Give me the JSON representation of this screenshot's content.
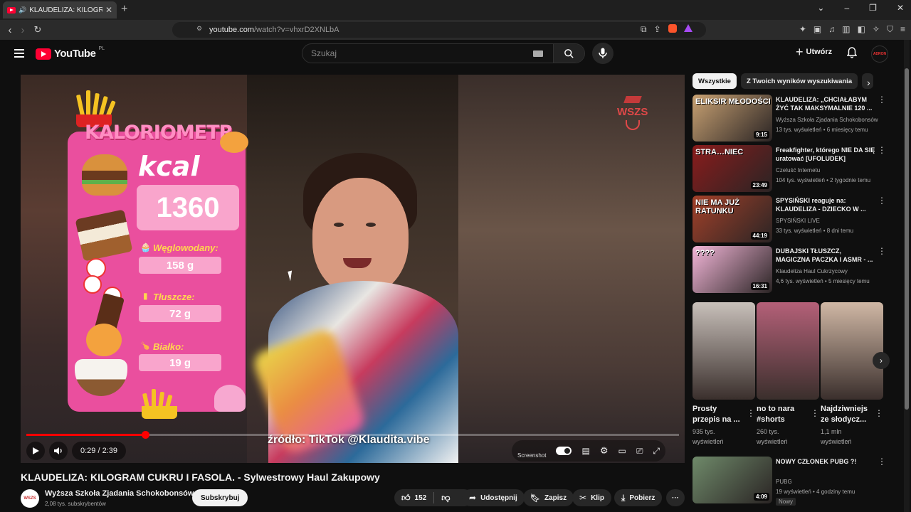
{
  "browser": {
    "tab_title": "KLAUDELIZA: KILOGRAM CUI",
    "tab_close": "✕",
    "new_tab": "+",
    "url_host": "youtube.com",
    "url_path": "/watch?v=vhxrD2XNLbA"
  },
  "header": {
    "logo_text": "YouTube",
    "region": "PL",
    "search_placeholder": "Szukaj",
    "create_label": "Utwórz",
    "avatar_text": "ADRON"
  },
  "player": {
    "overlay": {
      "title": "KALORIOMETR",
      "unit": "kcal",
      "kcal_value": "1360",
      "macros": [
        {
          "label": "Węglowodany:",
          "value": "158 g"
        },
        {
          "label": "Tłuszcze:",
          "value": "72 g"
        },
        {
          "label": "Białko:",
          "value": "19 g"
        }
      ],
      "watermark": "WSZS"
    },
    "caption": "źródło: TikTok @Klaudita.vibe",
    "time": "0:29 / 2:39",
    "progress_fraction": 0.1824,
    "screenshot_label": "Screenshot"
  },
  "video": {
    "title": "KLAUDELIZA: KILOGRAM CUKRU I FASOLA. - Sylwestrowy Haul Zakupowy",
    "channel_name": "Wyższa Szkoła Zjadania Schokobonsów",
    "channel_avatar": "WSZS",
    "subscribers": "2,08 tys. subskrybentów",
    "subscribe_label": "Subskrybuj",
    "like_count": "152",
    "share_label": "Udostępnij",
    "save_label": "Zapisz",
    "clip_label": "Klip",
    "download_label": "Pobierz"
  },
  "sidebar": {
    "chips": [
      "Wszystkie",
      "Z Twoich wyników wyszukiwania"
    ],
    "recommendations": [
      {
        "title": "KLAUDELIZA: „CHCIAŁABYM ŻYĆ TAK MAKSYMALNIE 120 ...",
        "channel": "Wyższa Szkoła Zjadania Schokobonsów",
        "meta": "13 tys. wyświetleń • 6 miesięcy temu",
        "duration": "9:15",
        "thumb_text": "ELIKSIR MŁODOŚCI",
        "thumb_color": "#c9a273"
      },
      {
        "title": "Freakfighter, którego NIE DA SIĘ uratować [UFOLUDEK]",
        "channel": "Czeluść Internetu",
        "meta": "104 tys. wyświetleń • 2 tygodnie temu",
        "duration": "23:49",
        "thumb_text": "STRA…NIEC",
        "thumb_color": "#8a1c1c"
      },
      {
        "title": "SPYSIŃSKI reaguje na: KLAUDELIZA - DZIECKO W ...",
        "channel": "SPYSIŃSKI LIVE",
        "meta": "33 tys. wyświetleń • 8 dni temu",
        "duration": "44:19",
        "thumb_text": "NIE MA JUŻ RATUNKU",
        "thumb_color": "#a3412a"
      },
      {
        "title": "DUBAJSKI TŁUSZCZ, MAGICZNA PACZKA I ASMR - ...",
        "channel": "Klaudeliza Haul Cukrzycowy",
        "meta": "4,6 tys. wyświetleń • 5 miesięcy temu",
        "duration": "16:31",
        "thumb_text": "????",
        "thumb_color": "#f3b6d8"
      },
      {
        "title": "NOWY CZŁONEK PUBG ?!",
        "channel": "PUBG",
        "meta": "19 wyświetleń • 4 godziny temu",
        "duration": "4:09",
        "badge": "Nowy",
        "thumb_text": "",
        "thumb_color": "#6f8a6a"
      }
    ],
    "shorts": [
      {
        "title": "Prosty przepis na ...",
        "views": "935 tys. wyświetleń",
        "thumb_color": "#c8c0ba"
      },
      {
        "title": "no to nara #shorts",
        "views": "260 tys. wyświetleń",
        "thumb_color": "#b46078"
      },
      {
        "title": "Najdziwniejs ze słodycz...",
        "views": "1,1 mln wyświetleń",
        "thumb_color": "#d0b8a5"
      }
    ]
  },
  "colors": {
    "brand_red": "#ff0033",
    "overlay_pink": "#ea4f9e",
    "overlay_box": "#f9a5cc",
    "macro_label": "#ffd84d"
  }
}
